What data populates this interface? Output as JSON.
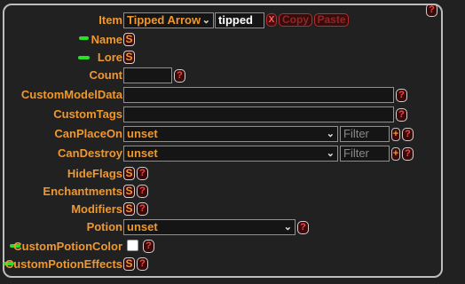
{
  "help_glyph": "?",
  "format_glyph": "S",
  "close_glyph": "X",
  "add_glyph": "+",
  "dropdown_glyph": "⌄",
  "item": {
    "label": "Item",
    "type_selected": "Tipped Arrow",
    "id_value": "tipped",
    "copy_label": "Copy",
    "paste_label": "Paste"
  },
  "fields": {
    "name": "Name",
    "lore": "Lore",
    "count": "Count",
    "custom_model_data": "CustomModelData",
    "custom_tags": "CustomTags",
    "can_place_on": "CanPlaceOn",
    "can_destroy": "CanDestroy",
    "hide_flags": "HideFlags",
    "enchantments": "Enchantments",
    "modifiers": "Modifiers",
    "potion": "Potion",
    "custom_potion_color": "CustomPotionColor",
    "custom_potion_effects": "CustomPotionEffects"
  },
  "values": {
    "count": "",
    "custom_model_data": "",
    "custom_tags": "",
    "can_place_on_selected": "unset",
    "can_destroy_selected": "unset",
    "potion_selected": "unset",
    "filter_placeholder": "Filter"
  },
  "colors": {
    "label": "#f0982e",
    "background": "#212121",
    "highlight_mark": "#29e029",
    "error_red": "#ff4040"
  }
}
